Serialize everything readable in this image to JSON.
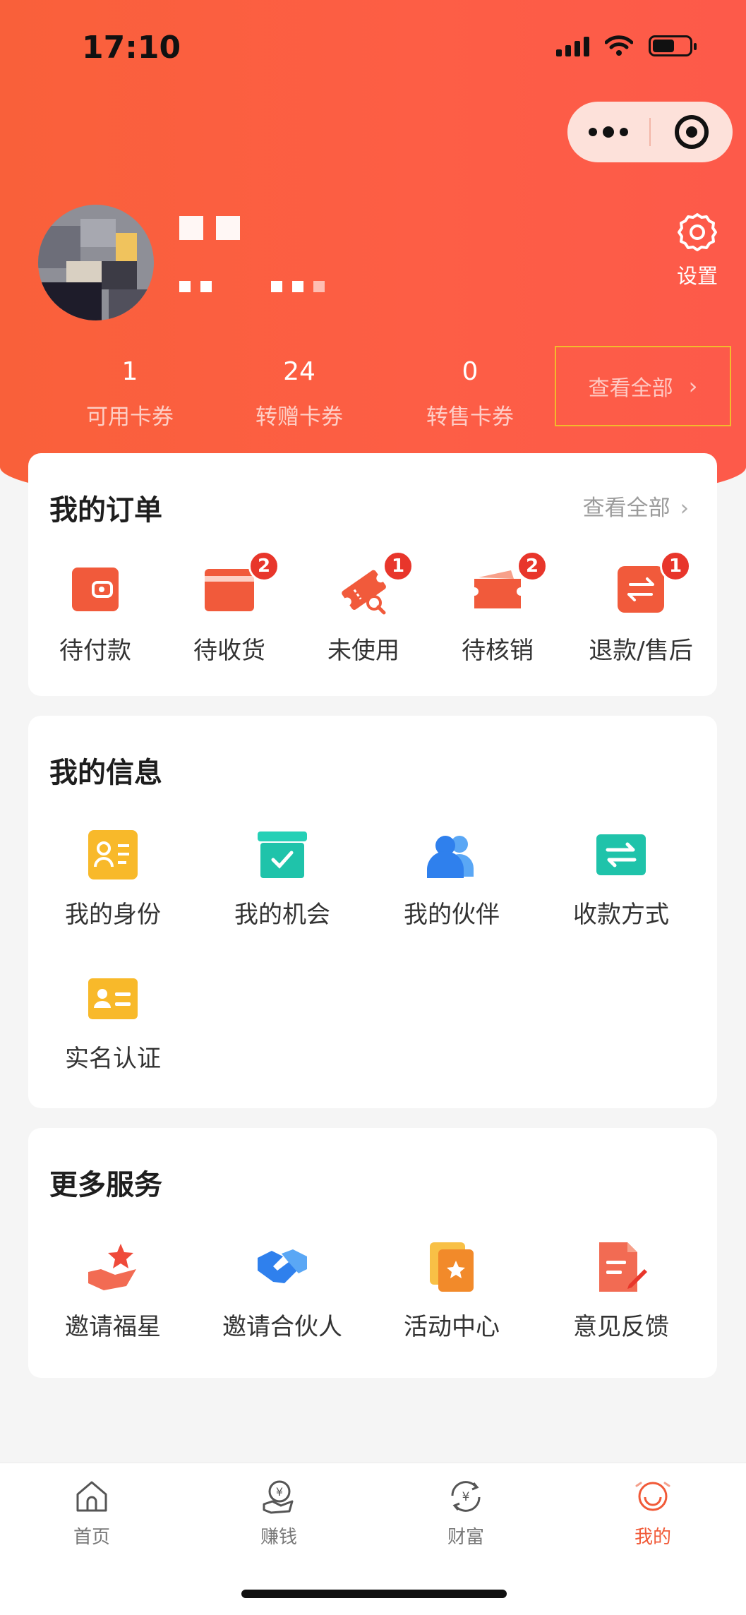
{
  "status": {
    "time": "17:10"
  },
  "profile": {
    "settings_label": "设置"
  },
  "stats": [
    {
      "value": "1",
      "label": "可用卡券"
    },
    {
      "value": "24",
      "label": "转赠卡券"
    },
    {
      "value": "0",
      "label": "转售卡券"
    }
  ],
  "stats_view_all": "查看全部",
  "orders": {
    "title": "我的订单",
    "view_all": "查看全部",
    "items": [
      {
        "label": "待付款",
        "badge": "",
        "icon": "wallet-icon"
      },
      {
        "label": "待收货",
        "badge": "2",
        "icon": "card-icon"
      },
      {
        "label": "未使用",
        "badge": "1",
        "icon": "ticket-icon"
      },
      {
        "label": "待核销",
        "badge": "2",
        "icon": "voucher-icon"
      },
      {
        "label": "退款/售后",
        "badge": "1",
        "icon": "refund-icon"
      }
    ]
  },
  "info": {
    "title": "我的信息",
    "items": [
      {
        "label": "我的身份",
        "icon": "id-card-icon"
      },
      {
        "label": "我的机会",
        "icon": "box-check-icon"
      },
      {
        "label": "我的伙伴",
        "icon": "partners-icon"
      },
      {
        "label": "收款方式",
        "icon": "transfer-icon"
      },
      {
        "label": "实名认证",
        "icon": "verify-card-icon"
      }
    ]
  },
  "services": {
    "title": "更多服务",
    "items": [
      {
        "label": "邀请福星",
        "icon": "star-hand-icon"
      },
      {
        "label": "邀请合伙人",
        "icon": "handshake-icon"
      },
      {
        "label": "活动中心",
        "icon": "activity-icon"
      },
      {
        "label": "意见反馈",
        "icon": "feedback-icon"
      }
    ]
  },
  "tabs": [
    {
      "label": "首页",
      "icon": "home-icon"
    },
    {
      "label": "赚钱",
      "icon": "earn-icon"
    },
    {
      "label": "财富",
      "icon": "wealth-icon"
    },
    {
      "label": "我的",
      "icon": "me-icon"
    }
  ],
  "colors": {
    "brand": "#f9603a",
    "badge": "#e8362b",
    "active_tab": "#f15a38"
  }
}
